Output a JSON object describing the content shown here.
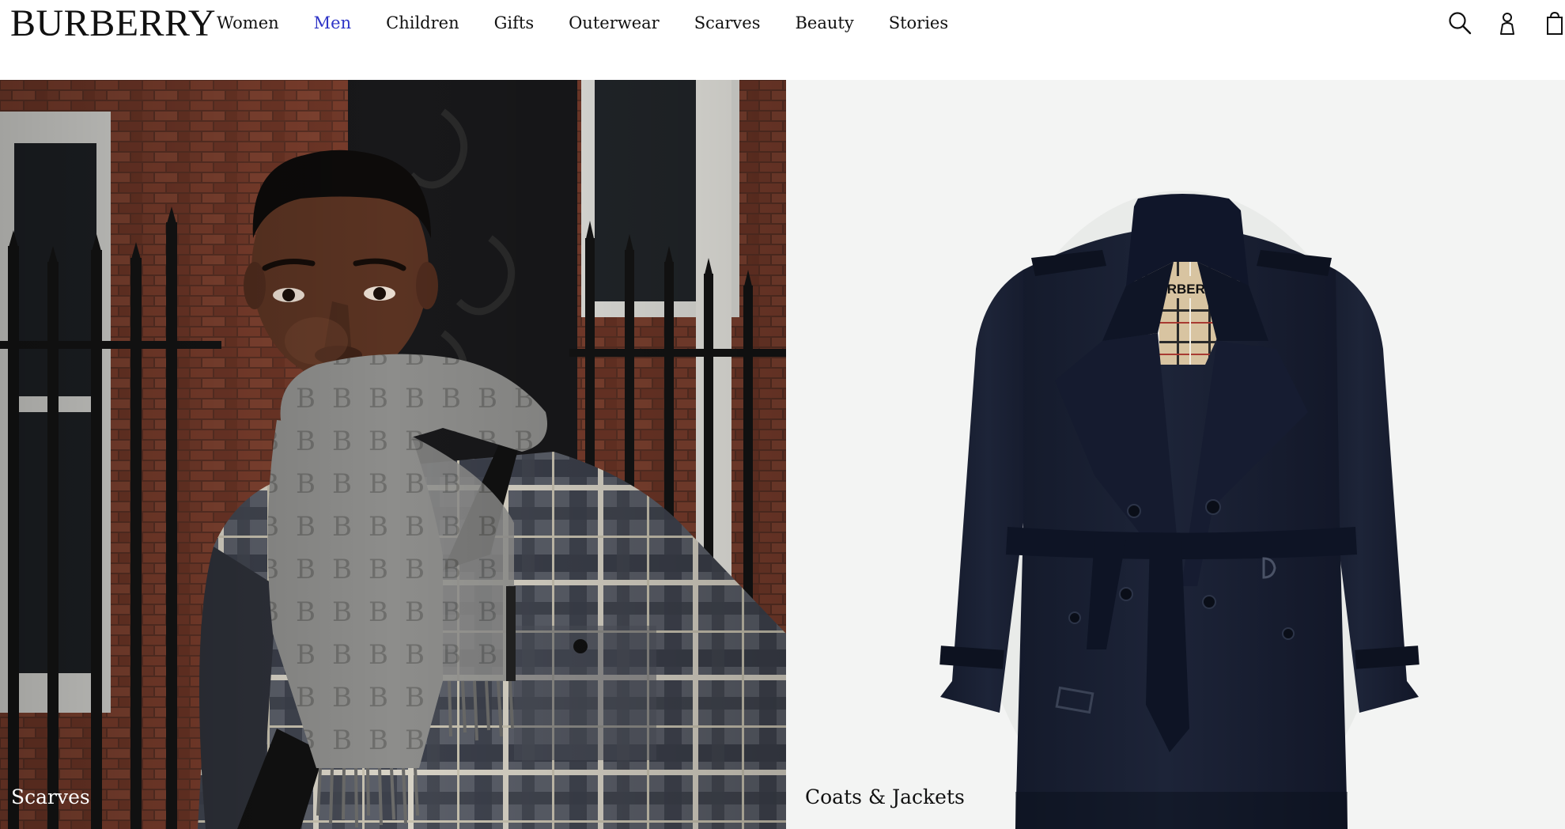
{
  "brand": {
    "logo": "BURBERRY"
  },
  "nav": {
    "items": [
      {
        "label": "Women",
        "active": false
      },
      {
        "label": "Men",
        "active": true
      },
      {
        "label": "Children",
        "active": false
      },
      {
        "label": "Gifts",
        "active": false
      },
      {
        "label": "Outerwear",
        "active": false
      },
      {
        "label": "Scarves",
        "active": false
      },
      {
        "label": "Beauty",
        "active": false
      },
      {
        "label": "Stories",
        "active": false
      }
    ],
    "active_color": "#2f35c7"
  },
  "header_icons": [
    "search-icon",
    "account-icon",
    "shopping-bag-icon"
  ],
  "panels": [
    {
      "label": "Scarves",
      "image": "man-wearing-grey-monogram-scarf-and-check-jacket"
    },
    {
      "label": "Coats & Jackets",
      "image": "navy-trench-coat-with-belt"
    }
  ],
  "coat_lining_text": "BURBERRY"
}
